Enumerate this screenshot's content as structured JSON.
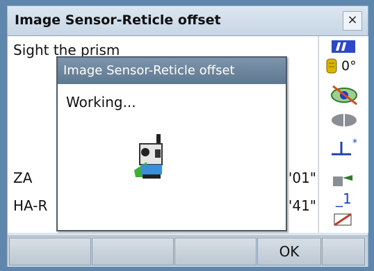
{
  "window": {
    "title": "Image Sensor-Reticle offset",
    "close_label": "×"
  },
  "background": {
    "prompt": "Sight the prism",
    "za_label": "ZA",
    "za_value": "'01\"",
    "ha_label": "HA-R",
    "ha_value": "'41\""
  },
  "right_status": {
    "angle_value": "0°",
    "mode_value": "_1"
  },
  "softkeys": [
    "",
    "",
    "",
    "OK",
    ""
  ],
  "dialog": {
    "title": "Image Sensor-Reticle offset",
    "message": "Working..."
  },
  "colors": {
    "accent_blue": "#1f3fbf",
    "battery": "#2a48c8"
  },
  "icons": [
    "battery-icon",
    "coin-icon",
    "target-icon",
    "prism-icon",
    "tilt-icon",
    "laser-icon",
    "eraser-icon",
    "total-station-icon"
  ]
}
